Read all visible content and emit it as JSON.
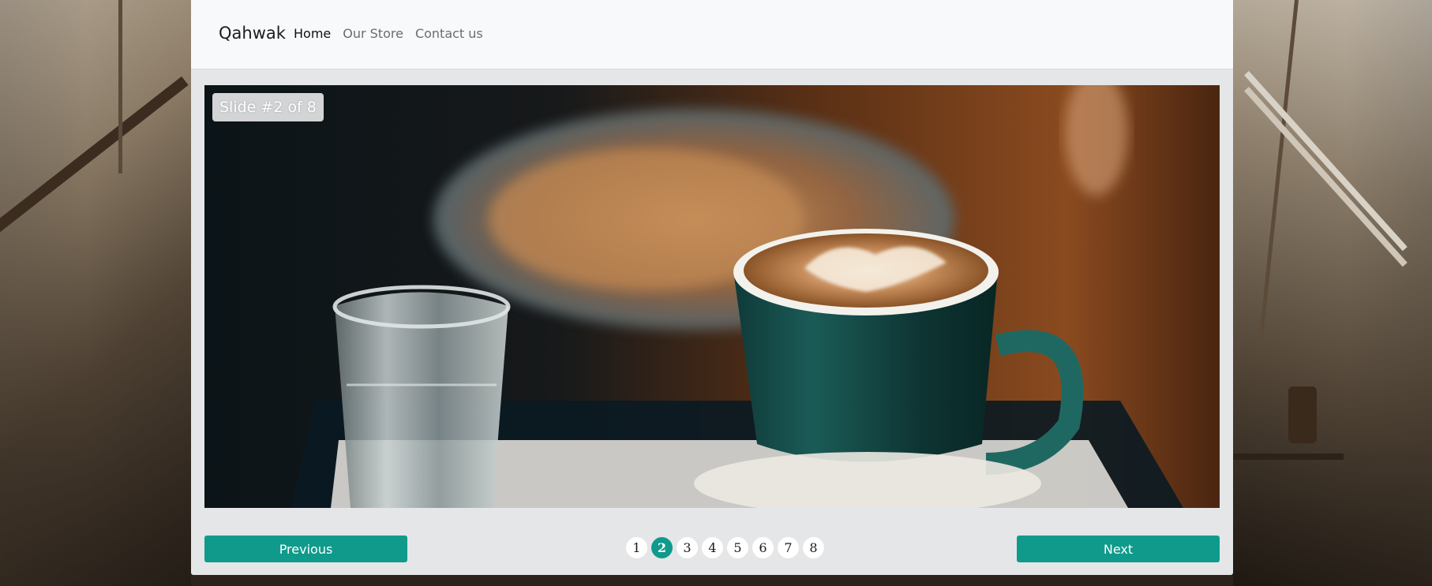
{
  "navbar": {
    "brand": "Qahwak",
    "links": [
      {
        "label": "Home",
        "active": true
      },
      {
        "label": "Our Store",
        "active": false
      },
      {
        "label": "Contact us",
        "active": false
      }
    ]
  },
  "slider": {
    "badge": "Slide #2 of 8",
    "current": 2,
    "total": 8,
    "previous_label": "Previous",
    "next_label": "Next",
    "pages": [
      "1",
      "2",
      "3",
      "4",
      "5",
      "6",
      "7",
      "8"
    ]
  },
  "colors": {
    "accent": "#109a8b",
    "navbar_bg": "#f8f9fa",
    "panel_bg": "#e5e6e8"
  }
}
